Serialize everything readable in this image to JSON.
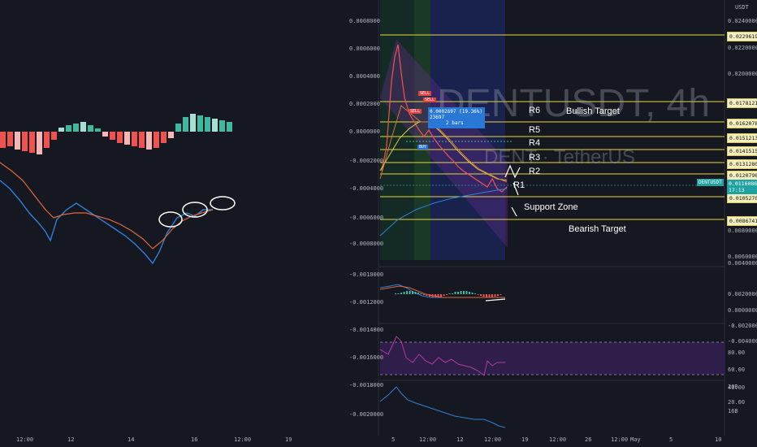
{
  "watermark": {
    "symbol": "DENTUSDT, 4h",
    "subtitle": "DENT · TetherUS"
  },
  "quote_currency": "USDT",
  "left_axis_ticks": [
    "0.0008000",
    "0.0006000",
    "0.0004000",
    "0.0002000",
    "0.0000000",
    "-0.0002000",
    "-0.0004000",
    "-0.0006000",
    "-0.0008000",
    "-0.0010000",
    "-0.0012000",
    "-0.0014000",
    "-0.0016000",
    "-0.0018000",
    "-0.0020000"
  ],
  "right_axis_ticks": [
    "0.0240000",
    "0.0220000",
    "0.0200000",
    "0.0080000",
    "0.0060000",
    "0.0040000",
    "0.0020000",
    "0.0000000",
    "-0.0020000",
    "-0.0040000",
    "80.00",
    "60.00",
    "40.00",
    "20.00",
    "20B",
    "16B"
  ],
  "price_tags": [
    "0.0229619",
    "0.0178121",
    "0.0162078",
    "0.0151213",
    "0.0141515",
    "0.0131280",
    "0.0120796",
    "0.0105270",
    "0.0086741"
  ],
  "last_price": {
    "symbol": "DENTUSDT",
    "value": "0.0116086",
    "countdown": "17:13"
  },
  "annotations": {
    "r6": "R6",
    "r5": "R5",
    "r4": "R4",
    "r3": "R3",
    "r2": "R2",
    "r1": "R1",
    "bullish": "Bullish Target",
    "support": "Support Zone",
    "bearish": "Bearish Target"
  },
  "trade_box": {
    "line1": "0.0002697 (19.36%) 23697",
    "line2": "2 bars"
  },
  "sell_labels": [
    "SELL",
    "SELL",
    "SELL"
  ],
  "buy_labels": [
    "BUY"
  ],
  "x_axis_left": [
    "12:00",
    "12",
    "12:00",
    "14",
    "16",
    "12:00",
    "19"
  ],
  "x_axis_main": [
    "5",
    "12:00",
    "12",
    "12:00",
    "19",
    "12:00",
    "26",
    "12:00",
    "May",
    "5",
    "10"
  ],
  "colors": {
    "background": "#151821",
    "level_line": "#e8d640",
    "hist_pos": "#3fb8a0",
    "hist_neg": "#ef5350",
    "macd_line": "#2f7fd6",
    "signal_line": "#e0673a",
    "rsi_band": "#3a1f5c",
    "channel": "#6a2f8f"
  },
  "chart_data": {
    "type": "line",
    "title": "DENTUSDT, 4h",
    "ylabel": "USDT",
    "ylim": [
      0.008,
      0.024
    ],
    "levels": [
      {
        "name": "",
        "value": 0.0229619
      },
      {
        "name": "R6 / Bullish Target",
        "value": 0.0178121
      },
      {
        "name": "R5",
        "value": 0.0162078
      },
      {
        "name": "R4",
        "value": 0.0151213
      },
      {
        "name": "R3",
        "value": 0.0141515
      },
      {
        "name": "R2",
        "value": 0.013128
      },
      {
        "name": "R1",
        "value": 0.0120796
      },
      {
        "name": "Support Zone",
        "value": 0.010527
      },
      {
        "name": "Bearish Target",
        "value": 0.0086741
      }
    ],
    "last_price": 0.0116086
  }
}
